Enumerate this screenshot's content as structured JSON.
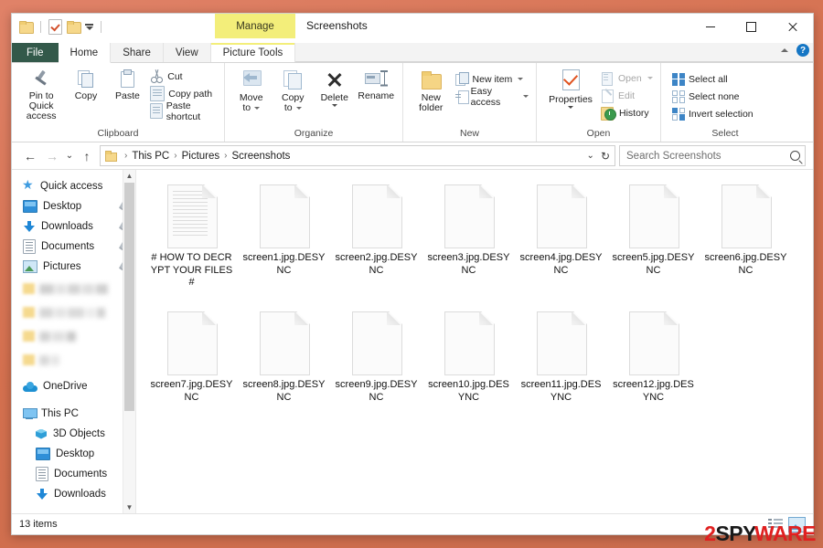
{
  "window": {
    "title": "Screenshots",
    "contextual_tab_header": "Manage",
    "controls": {
      "minimize": "–",
      "maximize": "□",
      "close": "✕"
    },
    "quick_access": [
      {
        "name": "folder-icon",
        "label": "Folder"
      },
      {
        "name": "properties-icon",
        "label": "Properties"
      },
      {
        "name": "new-folder-icon",
        "label": "New folder"
      },
      {
        "name": "customize-icon",
        "label": "Customize Quick Access Toolbar"
      }
    ]
  },
  "tabs": [
    {
      "id": "file",
      "label": "File"
    },
    {
      "id": "home",
      "label": "Home"
    },
    {
      "id": "share",
      "label": "Share"
    },
    {
      "id": "view",
      "label": "View"
    },
    {
      "id": "picture-tools",
      "label": "Picture Tools"
    }
  ],
  "ribbon": {
    "help_label": "?",
    "groups": [
      {
        "name": "Clipboard",
        "big": [
          {
            "label1": "Pin to Quick",
            "label2": "access"
          },
          {
            "label1": "Copy",
            "label2": ""
          },
          {
            "label1": "Paste",
            "label2": ""
          }
        ],
        "small": [
          {
            "label": "Cut"
          },
          {
            "label": "Copy path"
          },
          {
            "label": "Paste shortcut"
          }
        ]
      },
      {
        "name": "Organize",
        "big": [
          {
            "label1": "Move",
            "label2": "to"
          },
          {
            "label1": "Copy",
            "label2": "to"
          },
          {
            "label1": "Delete",
            "label2": ""
          },
          {
            "label1": "Rename",
            "label2": ""
          }
        ]
      },
      {
        "name": "New",
        "big": [
          {
            "label1": "New",
            "label2": "folder"
          }
        ],
        "small": [
          {
            "label": "New item"
          },
          {
            "label": "Easy access"
          }
        ]
      },
      {
        "name": "Open",
        "big": [
          {
            "label1": "Properties",
            "label2": ""
          }
        ],
        "small": [
          {
            "label": "Open"
          },
          {
            "label": "Edit"
          },
          {
            "label": "History"
          }
        ]
      },
      {
        "name": "Select",
        "small": [
          {
            "label": "Select all"
          },
          {
            "label": "Select none"
          },
          {
            "label": "Invert selection"
          }
        ]
      }
    ]
  },
  "address": {
    "breadcrumbs": [
      "This PC",
      "Pictures",
      "Screenshots"
    ],
    "separator": "›",
    "back_glyph": "←",
    "forward_glyph": "→",
    "recent_glyph": "⌄",
    "up_glyph": "↑",
    "dropdown_glyph": "⌄",
    "refresh_glyph": "↻"
  },
  "search": {
    "placeholder": "Search Screenshots",
    "value": ""
  },
  "sidebar": {
    "items": [
      {
        "label": "Quick access",
        "icon": "star-icon",
        "indent": 0,
        "pin": false
      },
      {
        "label": "Desktop",
        "icon": "desktop-icon",
        "indent": 0,
        "pin": true
      },
      {
        "label": "Downloads",
        "icon": "download-icon",
        "indent": 0,
        "pin": true
      },
      {
        "label": "Documents",
        "icon": "documents-icon",
        "indent": 0,
        "pin": true
      },
      {
        "label": "Pictures",
        "icon": "pictures-icon",
        "indent": 0,
        "pin": true
      },
      {
        "label": "",
        "icon": "folder-icon",
        "indent": 0,
        "pin": false,
        "redacted": true
      },
      {
        "label": "",
        "icon": "folder-icon",
        "indent": 0,
        "pin": false,
        "redacted": true
      },
      {
        "label": "",
        "icon": "folder-icon",
        "indent": 0,
        "pin": false,
        "redacted": true
      },
      {
        "label": "",
        "icon": "folder-icon",
        "indent": 0,
        "pin": false,
        "redacted": true
      },
      {
        "label": "OneDrive",
        "icon": "onedrive-icon",
        "indent": 0,
        "pin": false
      },
      {
        "label": "This PC",
        "icon": "pc-icon",
        "indent": 0,
        "pin": false
      },
      {
        "label": "3D Objects",
        "icon": "3d-objects-icon",
        "indent": 1,
        "pin": false
      },
      {
        "label": "Desktop",
        "icon": "desktop-icon",
        "indent": 1,
        "pin": false
      },
      {
        "label": "Documents",
        "icon": "documents-icon",
        "indent": 1,
        "pin": false
      },
      {
        "label": "Downloads",
        "icon": "download-icon",
        "indent": 1,
        "pin": false
      }
    ]
  },
  "files": [
    {
      "name": "# HOW TO DECRYPT YOUR FILES #",
      "type": "text-document",
      "lined": true
    },
    {
      "name": "screen1.jpg.DESYNC",
      "type": "encrypted-file",
      "lined": false
    },
    {
      "name": "screen2.jpg.DESYNC",
      "type": "encrypted-file",
      "lined": false
    },
    {
      "name": "screen3.jpg.DESYNC",
      "type": "encrypted-file",
      "lined": false
    },
    {
      "name": "screen4.jpg.DESYNC",
      "type": "encrypted-file",
      "lined": false
    },
    {
      "name": "screen5.jpg.DESYNC",
      "type": "encrypted-file",
      "lined": false
    },
    {
      "name": "screen6.jpg.DESYNC",
      "type": "encrypted-file",
      "lined": false
    },
    {
      "name": "screen7.jpg.DESYNC",
      "type": "encrypted-file",
      "lined": false
    },
    {
      "name": "screen8.jpg.DESYNC",
      "type": "encrypted-file",
      "lined": false
    },
    {
      "name": "screen9.jpg.DESYNC",
      "type": "encrypted-file",
      "lined": false
    },
    {
      "name": "screen10.jpg.DESYNC",
      "type": "encrypted-file",
      "lined": false
    },
    {
      "name": "screen11.jpg.DESYNC",
      "type": "encrypted-file",
      "lined": false
    },
    {
      "name": "screen12.jpg.DESYNC",
      "type": "encrypted-file",
      "lined": false
    }
  ],
  "status": {
    "item_count": "13 items",
    "view_details_label": "Details view",
    "view_thumbnails_label": "Large icons view"
  },
  "watermark": {
    "part1": "2",
    "part2": "SPY",
    "part3": "WARE"
  },
  "colors": {
    "desktop_background": "#d9745c",
    "file_tab": "#33594a",
    "contextual_tab": "#f3ee7a",
    "accent_blue": "#1576c4",
    "watermark_red": "#e02020"
  }
}
